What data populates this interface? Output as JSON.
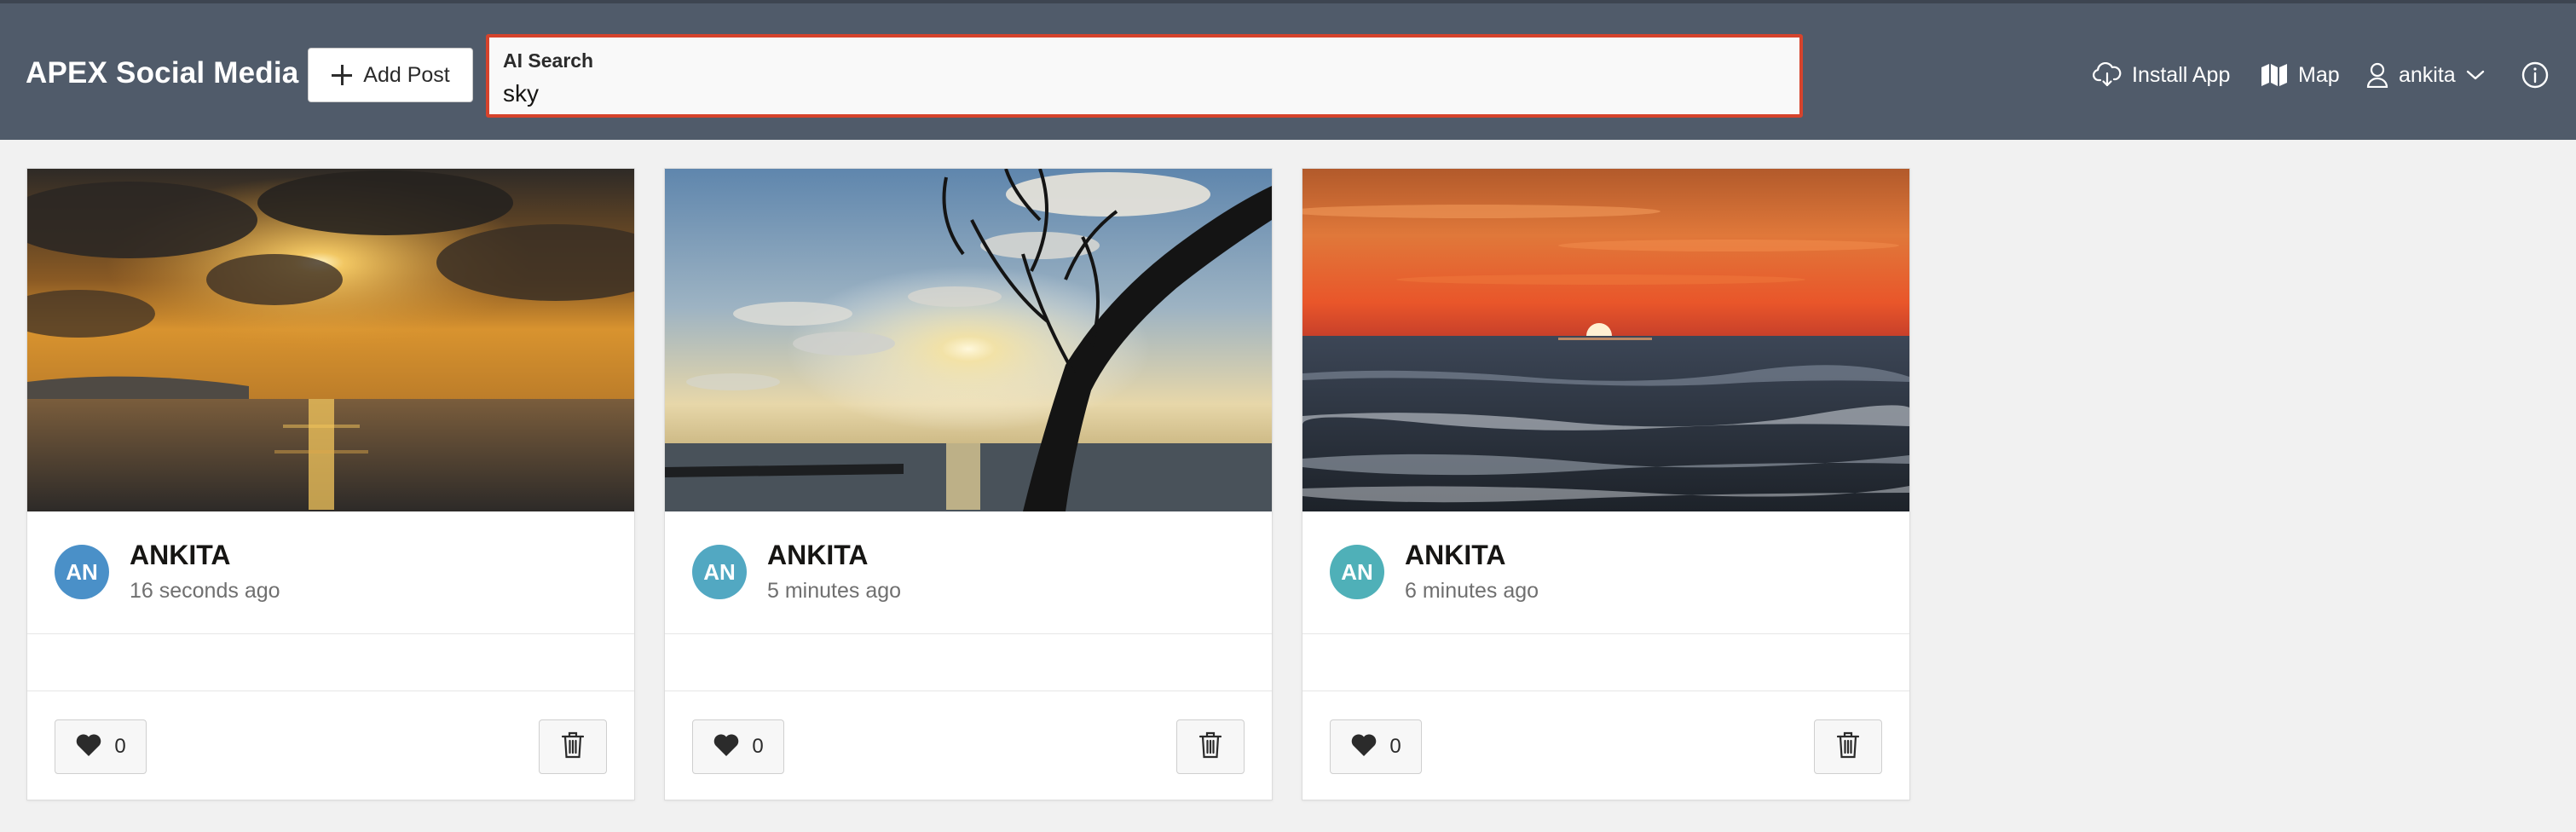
{
  "header": {
    "app_title": "APEX Social Media",
    "add_post_label": "Add Post",
    "search": {
      "label": "AI Search",
      "value": "sky"
    },
    "install_label": "Install App",
    "map_label": "Map",
    "user_label": "ankita"
  },
  "colors": {
    "header_bg": "#505b6a",
    "search_border": "#d6432c",
    "avatar_1": "#4a90c8",
    "avatar_2": "#52a8c2",
    "avatar_3": "#4fb0b8"
  },
  "posts": [
    {
      "author": "ANKITA",
      "initials": "AN",
      "time": "16 seconds ago",
      "likes": "0",
      "image": "sunset-clouds-over-water"
    },
    {
      "author": "ANKITA",
      "initials": "AN",
      "time": "5 minutes ago",
      "likes": "0",
      "image": "tree-silhouette-beach-sun"
    },
    {
      "author": "ANKITA",
      "initials": "AN",
      "time": "6 minutes ago",
      "likes": "0",
      "image": "orange-sunset-over-sea"
    }
  ],
  "icons": {
    "add": "plus-icon",
    "install": "cloud-download-icon",
    "map": "map-icon",
    "user": "user-icon",
    "dropdown": "chevron-down-icon",
    "info": "info-icon",
    "like": "heart-icon",
    "delete": "trash-icon"
  }
}
